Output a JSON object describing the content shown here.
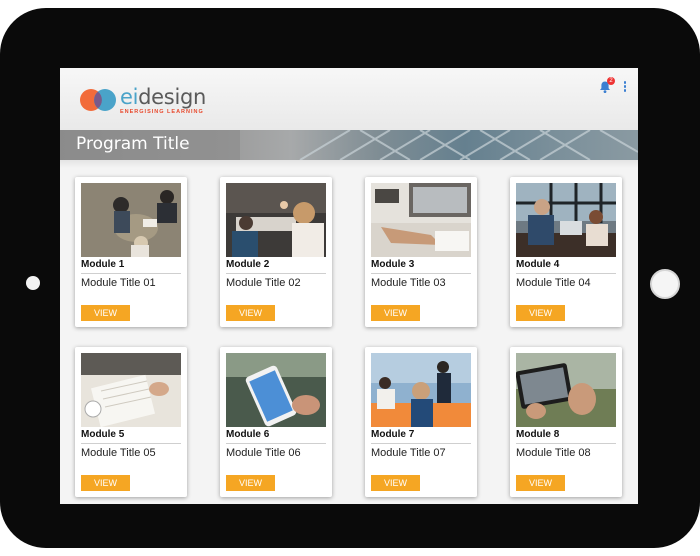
{
  "app": {
    "logo_text_prefix": "ei",
    "logo_text_suffix": "design",
    "logo_tagline": "ENERGISING LEARNING",
    "notification_count": "2"
  },
  "banner": {
    "title": "Program Title"
  },
  "modules": [
    {
      "label": "Module 1",
      "title": "Module Title 01",
      "button": "VIEW"
    },
    {
      "label": "Module 2",
      "title": "Module Title 02",
      "button": "VIEW"
    },
    {
      "label": "Module 3",
      "title": "Module Title 03",
      "button": "VIEW"
    },
    {
      "label": "Module 4",
      "title": "Module Title 04",
      "button": "VIEW"
    },
    {
      "label": "Module 5",
      "title": "Module Title 05",
      "button": "VIEW"
    },
    {
      "label": "Module 6",
      "title": "Module Title 06",
      "button": "VIEW"
    },
    {
      "label": "Module 7",
      "title": "Module Title 07",
      "button": "VIEW"
    },
    {
      "label": "Module 8",
      "title": "Module Title 08",
      "button": "VIEW"
    }
  ],
  "colors": {
    "accent_button": "#f5a623",
    "logo_orange": "#f26b3a",
    "logo_blue": "#4aa3c9",
    "tagline_red": "#e84a2e",
    "notification_blue": "#3b7fd1"
  },
  "icons": [
    "bell-icon",
    "more-vertical-icon"
  ]
}
